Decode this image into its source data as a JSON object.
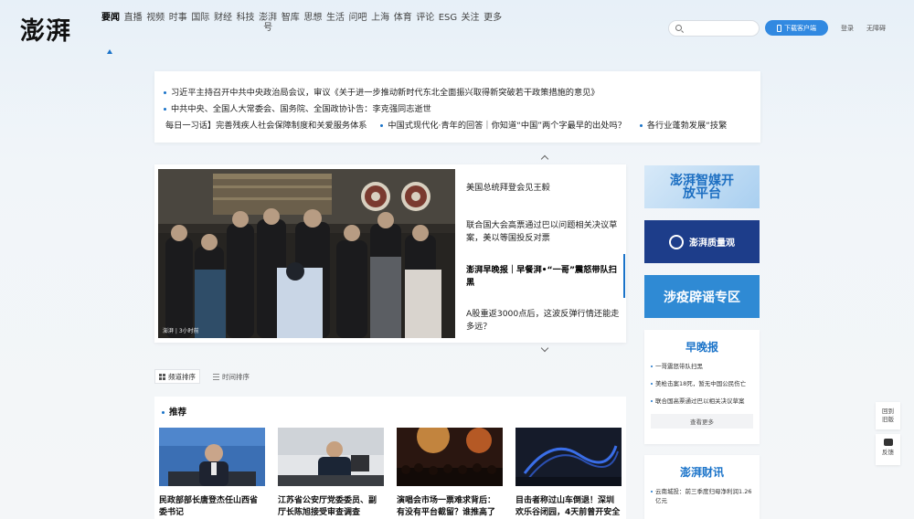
{
  "header": {
    "logo": "澎湃",
    "nav": [
      "要闻",
      "直播",
      "视频",
      "时事",
      "国际",
      "财经",
      "科技",
      "澎湃号",
      "智库",
      "思想",
      "生活",
      "问吧",
      "上海",
      "体育",
      "评论",
      "ESG",
      "关注",
      "更多"
    ],
    "active_nav_index": 0,
    "search_placeholder": "",
    "download_label": "下载客户端",
    "login_label": "登录",
    "accessibility_label": "无障碍"
  },
  "ticker": {
    "lines": [
      "习近平主持召开中共中央政治局会议，审议《关于进一步推动新时代东北全面振兴取得新突破若干政策措施的意见》",
      "中共中央、全国人大常委会、国务院、全国政协讣告：李克强同志逝世"
    ],
    "row3": [
      "每日一习话】完善残疾人社会保障制度和关爱服务体系",
      "中国式现代化·青年的回答｜你知道“中国”两个字最早的出处吗？",
      "各行业蓬勃发展“技繁"
    ]
  },
  "hero": {
    "image_source": "澎湃 | 3小时前",
    "items": [
      "美国总统拜登会见王毅",
      "联合国大会高票通过巴以问题相关决议草案，美以等国投反对票",
      "澎湃早晚报｜早餐湃•“一哥”震怒带队扫黑",
      "A股重返3000点后，这波反弹行情还能走多远？"
    ],
    "active_index": 2
  },
  "sort_tabs": [
    "频道排序",
    "时间排序"
  ],
  "recommend": {
    "title": "推荐",
    "cards": [
      "民政部部长唐登杰任山西省委书记",
      "江苏省公安厅党委委员、副厅长陈旭接受审查调查",
      "演唱会市场一票难求背后：有没有平台截留？谁推高了票价？",
      "目击者称过山车倒退！深圳欢乐谷闭园，4天前曾开安全生产工作会"
    ]
  },
  "sidebar": {
    "banners": [
      "澎湃智媒开放平台",
      "澎湃质量观",
      "涉疫辟谣专区"
    ],
    "zaowanbao": {
      "title": "早晚报",
      "items": [
        "一哥震怒带队扫黑",
        "美枪击案18死，暂无中国公民伤亡",
        "联合国高票通过巴以相关决议草案"
      ],
      "more": "查看更多"
    },
    "caixun": {
      "title": "澎湃财讯",
      "items": [
        "云南城投：前三季度归母净利润1.26亿元"
      ]
    }
  },
  "float": {
    "back_old": "回到旧版",
    "feedback": "反馈"
  },
  "colors": {
    "accent": "#1a73c9",
    "download": "#3189e1"
  }
}
